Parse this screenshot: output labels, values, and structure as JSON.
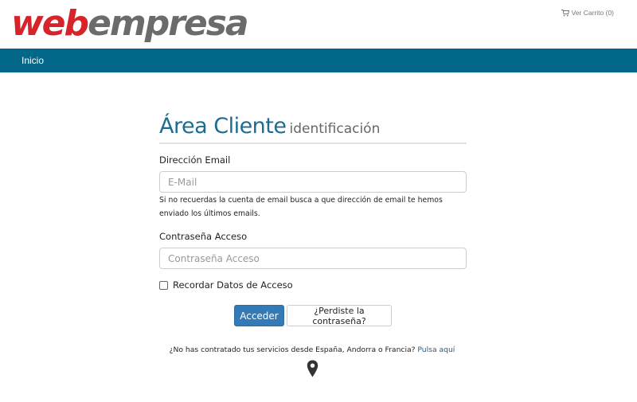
{
  "header": {
    "logo": {
      "part1": "web",
      "part2": "empresa"
    },
    "cart_label": "Ver Carrito (0)",
    "cart_icon": "shopping-cart-icon"
  },
  "nav": {
    "home_label": "Inicio"
  },
  "login": {
    "title_main": "Área Cliente",
    "title_sub": "identificación",
    "email_label": "Dirección Email",
    "email_placeholder": "E-Mail",
    "email_value": "",
    "email_help": "Si no recuerdas la cuenta de email busca a que dirección de email te hemos enviado los últimos emails.",
    "password_label": "Contraseña Acceso",
    "password_placeholder": "Contraseña Acceso",
    "password_value": "",
    "remember_label": "Recordar Datos de Acceso",
    "remember_checked": false,
    "submit_label": "Acceder",
    "forgot_label": "¿Perdiste la contraseña?"
  },
  "footer": {
    "notice_text": "¿No has contratado tus servicios desde España, Andorra o Francia?",
    "notice_link": "Pulsa aquí",
    "location_icon": "map-marker-icon"
  },
  "colors": {
    "brand_red": "#d8232a",
    "brand_gray": "#6b6b6b",
    "nav_bg": "#03678a",
    "title_blue": "#1e6c90",
    "primary_button": "#337ab7",
    "link": "#1e5d84"
  }
}
